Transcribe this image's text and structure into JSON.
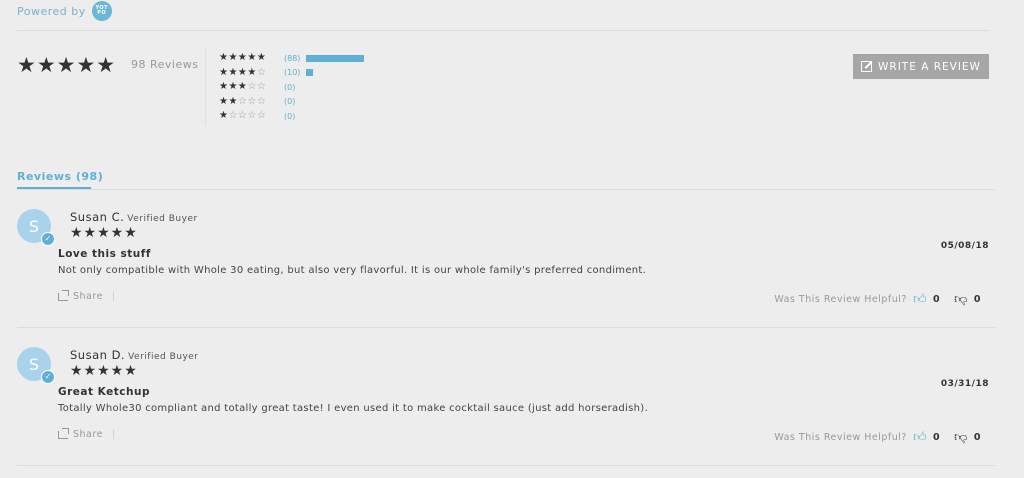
{
  "powered_by": {
    "label": "Powered by",
    "logo_text": "YOT PO"
  },
  "summary": {
    "average_rating": 5,
    "stars": "★★★★★",
    "total_label": "98 Reviews",
    "distribution": [
      {
        "stars": 5,
        "filled": "★★★★★",
        "empty": "",
        "count_label": "(88)",
        "fraction": 0.898
      },
      {
        "stars": 4,
        "filled": "★★★★",
        "empty": "☆",
        "count_label": "(10)",
        "fraction": 0.102
      },
      {
        "stars": 3,
        "filled": "★★★",
        "empty": "☆☆",
        "count_label": "(0)",
        "fraction": 0
      },
      {
        "stars": 2,
        "filled": "★★",
        "empty": "☆☆☆",
        "count_label": "(0)",
        "fraction": 0
      },
      {
        "stars": 1,
        "filled": "★",
        "empty": "☆☆☆☆",
        "count_label": "(0)",
        "fraction": 0
      }
    ],
    "write_button": "WRITE A REVIEW"
  },
  "tabs": {
    "reviews": "Reviews (98)"
  },
  "reviews": [
    {
      "avatar": "S",
      "name": "Susan C.",
      "badge": "Verified Buyer",
      "stars": "★★★★★",
      "date": "05/08/18",
      "title": "Love this stuff",
      "body": "Not only compatible with Whole 30 eating, but also very flavorful. It is our whole family's preferred condiment.",
      "share": "Share",
      "helpful_label": "Was This Review Helpful?",
      "up": "0",
      "down": "0"
    },
    {
      "avatar": "S",
      "name": "Susan D.",
      "badge": "Verified Buyer",
      "stars": "★★★★★",
      "date": "03/31/18",
      "title": "Great Ketchup",
      "body": "Totally Whole30 compliant and totally great taste! I even used it to make cocktail sauce (just add horseradish).",
      "share": "Share",
      "helpful_label": "Was This Review Helpful?",
      "up": "0",
      "down": "0"
    }
  ],
  "colors": {
    "accent": "#5fb0d4",
    "button": "#a6a6a6",
    "background": "#ededed"
  }
}
